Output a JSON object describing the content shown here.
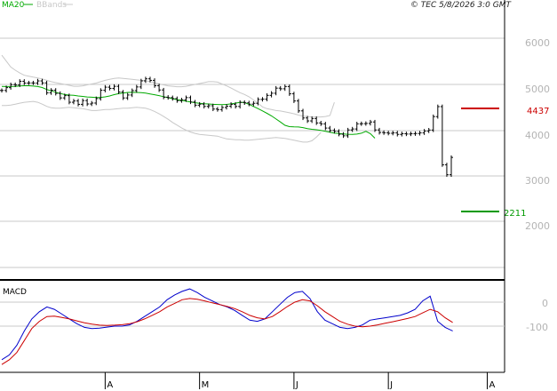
{
  "legend": {
    "ma_label": "MA20",
    "bb_label": "BBands",
    "ma_color": "#00aa00",
    "bb_color": "#c8c8c8"
  },
  "timestamp": "© TEC 5/8/2026 3:0 GMT",
  "panels": {
    "macd_label": "MACD"
  },
  "colors": {
    "price": "#000000",
    "resistance": "#cc0000",
    "support": "#009900",
    "macd_line": "#0000cc",
    "signal_line": "#cc0000",
    "grid": "#c8c8c8",
    "axis_text": "#b4b4b4"
  },
  "chart_data": [
    {
      "type": "line",
      "title": "",
      "ylim": [
        1000,
        6950
      ],
      "y_ticks": [
        "6000",
        "5000",
        "4000",
        "3000",
        "2000"
      ],
      "y_tick_values": [
        6000,
        5000,
        4000,
        3000,
        2000
      ],
      "x_month_labels": [
        {
          "label": "A",
          "index": 23
        },
        {
          "label": "M",
          "index": 44
        },
        {
          "label": "J",
          "index": 65
        },
        {
          "label": "J",
          "index": 86
        },
        {
          "label": "A",
          "index": 108
        }
      ],
      "levels": [
        {
          "name": "resistance",
          "label": "4437",
          "value": 4537
        },
        {
          "name": "support",
          "label": "2211",
          "value": 2211
        }
      ],
      "series": [
        {
          "kind": "price-bars",
          "values": [
            4859,
            4920,
            4985,
            4978,
            5059,
            5021,
            5024,
            5022,
            5067,
            5024,
            4807,
            4864,
            4794,
            4696,
            4745,
            4601,
            4629,
            4555,
            4637,
            4563,
            4583,
            4681,
            4862,
            4930,
            4904,
            4948,
            4824,
            4695,
            4759,
            4856,
            4935,
            5068,
            5113,
            5079,
            4962,
            4869,
            4711,
            4702,
            4681,
            4634,
            4654,
            4702,
            4606,
            4537,
            4559,
            4510,
            4524,
            4452,
            4440,
            4487,
            4515,
            4555,
            4509,
            4598,
            4588,
            4559,
            4578,
            4662,
            4668,
            4751,
            4798,
            4909,
            4895,
            4944,
            4785,
            4629,
            4412,
            4257,
            4193,
            4245,
            4149,
            4128,
            4037,
            3984,
            3965,
            3902,
            3867,
            3996,
            4017,
            4129,
            4133,
            4138,
            4170,
            3996,
            3940,
            3933,
            3923,
            3931,
            3898,
            3913,
            3906,
            3912,
            3918,
            3931,
            3972,
            3994,
            4287,
            4505,
            3234,
            3017,
            3395
          ]
        },
        {
          "name": "MA20",
          "values": [
            4945,
            4943,
            4944,
            4947,
            4957,
            4961,
            4962,
            4953,
            4943,
            4923,
            4880,
            4851,
            4820,
            4793,
            4768,
            4757,
            4751,
            4738,
            4728,
            4716,
            4710,
            4703,
            4707,
            4719,
            4737,
            4767,
            4789,
            4802,
            4815,
            4817,
            4815,
            4809,
            4800,
            4783,
            4765,
            4745,
            4723,
            4701,
            4678,
            4658,
            4643,
            4624,
            4606,
            4590,
            4578,
            4568,
            4563,
            4556,
            4551,
            4548,
            4553,
            4565,
            4581,
            4600,
            4595,
            4556,
            4509,
            4463,
            4411,
            4360,
            4302,
            4235,
            4168,
            4098,
            4068,
            4063,
            4061,
            4047,
            4025,
            4010,
            4000,
            3986,
            3966,
            3945,
            3924,
            3916,
            3908,
            3901,
            3899,
            3904,
            3925,
            3965,
            3914,
            3815
          ]
        },
        {
          "name": "BBands upper",
          "values": [
            5630,
            5500,
            5370,
            5300,
            5240,
            5190,
            5170,
            5150,
            5130,
            5110,
            5080,
            5050,
            5030,
            5010,
            4990,
            4970,
            4950,
            4950,
            4960,
            4980,
            5000,
            5020,
            5050,
            5080,
            5100,
            5120,
            5130,
            5120,
            5110,
            5100,
            5090,
            5080,
            5070,
            5050,
            5030,
            5000,
            4980,
            4960,
            4950,
            4940,
            4940,
            4950,
            4970,
            4990,
            5010,
            5030,
            5050,
            5050,
            5040,
            5000,
            4960,
            4910,
            4860,
            4810,
            4770,
            4720,
            4650,
            4580,
            4500,
            4460,
            4440,
            4420,
            4410,
            4390,
            4370,
            4350,
            4320,
            4300,
            4290,
            4280,
            4280,
            4280,
            4290,
            4310,
            4600
          ]
        },
        {
          "name": "BBands lower",
          "values": [
            4530,
            4530,
            4540,
            4560,
            4580,
            4600,
            4610,
            4620,
            4600,
            4560,
            4510,
            4480,
            4470,
            4470,
            4480,
            4490,
            4480,
            4470,
            4460,
            4440,
            4420,
            4420,
            4430,
            4440,
            4440,
            4450,
            4460,
            4470,
            4470,
            4480,
            4490,
            4480,
            4470,
            4440,
            4400,
            4350,
            4290,
            4230,
            4160,
            4100,
            4040,
            3990,
            3950,
            3920,
            3900,
            3890,
            3880,
            3870,
            3860,
            3830,
            3800,
            3790,
            3780,
            3780,
            3770,
            3770,
            3780,
            3790,
            3800,
            3810,
            3820,
            3830,
            3820,
            3810,
            3790,
            3770,
            3750,
            3730,
            3730,
            3760,
            3840,
            3940
          ]
        }
      ]
    },
    {
      "type": "line",
      "title": "MACD",
      "ylim": [
        -270,
        80
      ],
      "y_ticks": [
        "0",
        "-100"
      ],
      "y_tick_values": [
        0,
        -100
      ],
      "series": [
        {
          "name": "MACD",
          "values": [
            -240,
            -220,
            -180,
            -120,
            -70,
            -40,
            -20,
            -30,
            -50,
            -70,
            -90,
            -105,
            -110,
            -108,
            -104,
            -100,
            -100,
            -95,
            -80,
            -60,
            -40,
            -20,
            10,
            30,
            45,
            55,
            40,
            20,
            5,
            -10,
            -20,
            -35,
            -55,
            -75,
            -80,
            -70,
            -40,
            -10,
            20,
            40,
            45,
            15,
            -40,
            -75,
            -90,
            -105,
            -110,
            -105,
            -95,
            -75,
            -70,
            -65,
            -60,
            -55,
            -45,
            -30,
            5,
            25,
            -80,
            -105,
            -120
          ]
        },
        {
          "name": "Signal",
          "values": [
            -260,
            -240,
            -210,
            -160,
            -110,
            -80,
            -60,
            -58,
            -64,
            -70,
            -78,
            -86,
            -92,
            -96,
            -97,
            -96,
            -94,
            -90,
            -82,
            -70,
            -55,
            -40,
            -20,
            -5,
            10,
            15,
            12,
            5,
            -3,
            -10,
            -18,
            -27,
            -40,
            -55,
            -65,
            -70,
            -60,
            -40,
            -18,
            0,
            10,
            5,
            -15,
            -40,
            -60,
            -80,
            -92,
            -100,
            -103,
            -100,
            -95,
            -88,
            -82,
            -75,
            -68,
            -60,
            -45,
            -30,
            -40,
            -65,
            -85
          ]
        }
      ]
    }
  ]
}
